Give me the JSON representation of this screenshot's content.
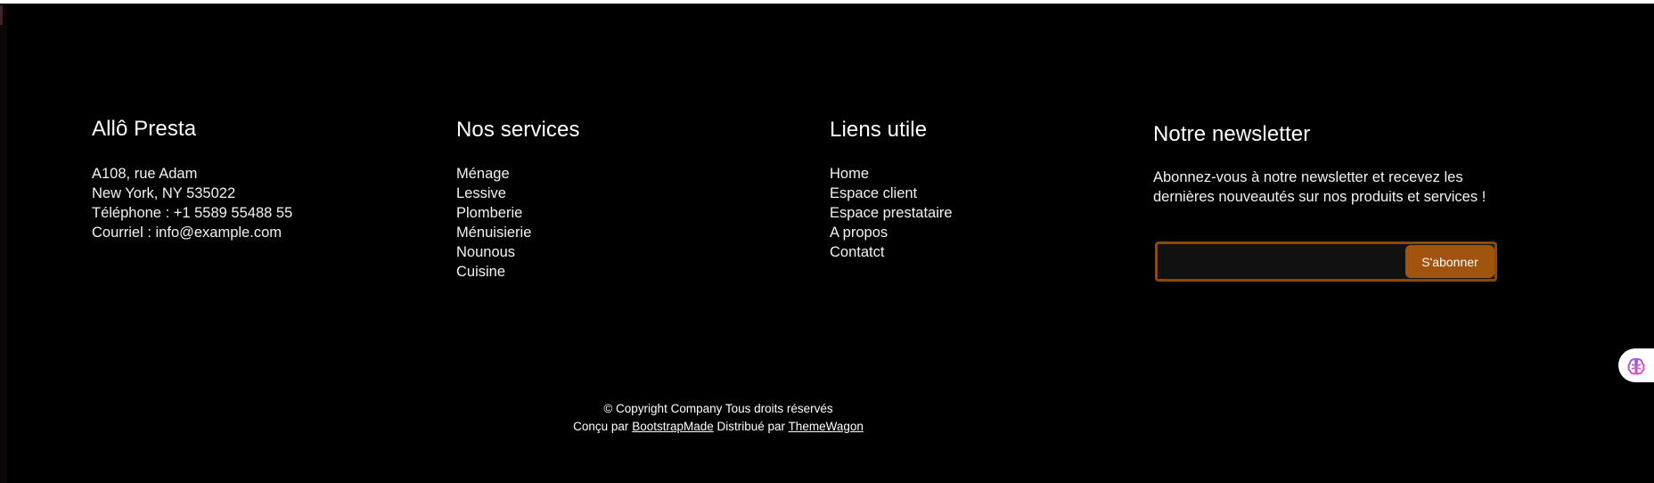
{
  "brand": {
    "title": "Allô Presta",
    "address1": "A108, rue Adam",
    "address2": "New York, NY 535022",
    "phone": "Téléphone : +1 5589 55488 55",
    "email": "Courriel : info@example.com"
  },
  "services": {
    "title": "Nos services",
    "items": [
      "Ménage",
      "Lessive",
      "Plomberie",
      "Ménuisierie",
      "Nounous",
      "Cuisine"
    ]
  },
  "links": {
    "title": "Liens utile",
    "items": [
      "Home",
      "Espace client",
      "Espace prestataire",
      "A propos",
      "Contatct"
    ]
  },
  "newsletter": {
    "title": "Notre newsletter",
    "text_line1": "Abonnez-vous à notre newsletter et recevez les",
    "text_line2": "dernières nouveautés sur nos produits et services !",
    "input_value": "",
    "button_label": "S'abonner"
  },
  "footer": {
    "copyright": "© Copyright Company Tous droits réservés",
    "designed_prefix": "Conçu par",
    "designed_link": "BootstrapMade",
    "distributed_prefix": "Distribué par",
    "distributed_link": "ThemeWagon"
  },
  "colors": {
    "background": "#000000",
    "accent": "#a0540e",
    "accent_border": "#8a4a0a"
  },
  "icons": {
    "side_widget": "brain-icon"
  }
}
